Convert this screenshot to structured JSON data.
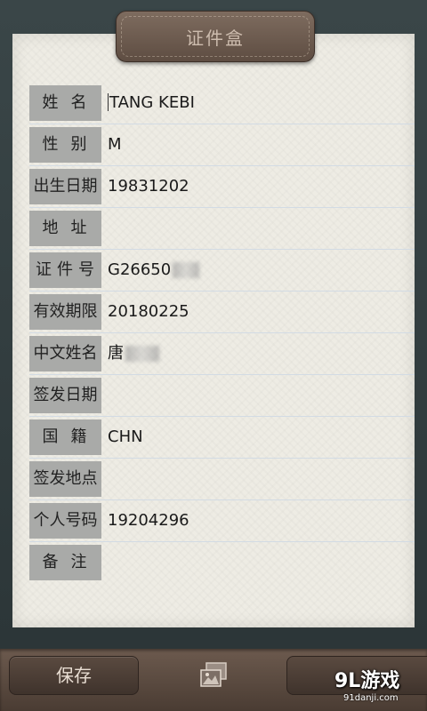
{
  "header": {
    "title": "证件盒"
  },
  "fields": [
    {
      "label": "姓名",
      "value": "TANG KEBI"
    },
    {
      "label": "性别",
      "value": "M"
    },
    {
      "label": "出生日期",
      "value": "19831202"
    },
    {
      "label": "地址",
      "value": ""
    },
    {
      "label": "证件号",
      "value": "G26650"
    },
    {
      "label": "有效期限",
      "value": "20180225"
    },
    {
      "label": "中文姓名",
      "value": "唐"
    },
    {
      "label": "签发日期",
      "value": ""
    },
    {
      "label": "国籍",
      "value": "CHN"
    },
    {
      "label": "签发地点",
      "value": ""
    },
    {
      "label": "个人号码",
      "value": "19204296"
    },
    {
      "label": "备注",
      "value": ""
    }
  ],
  "toolbar": {
    "save_label": "保存",
    "gallery_icon": "gallery-icon"
  },
  "watermark": {
    "main": "9L游戏",
    "sub": "91danji.com"
  },
  "colors": {
    "frame": "#2f3a3c",
    "paper": "#eeece4",
    "label_bg": "#a9aaa8",
    "bar": "#5a4a40"
  }
}
